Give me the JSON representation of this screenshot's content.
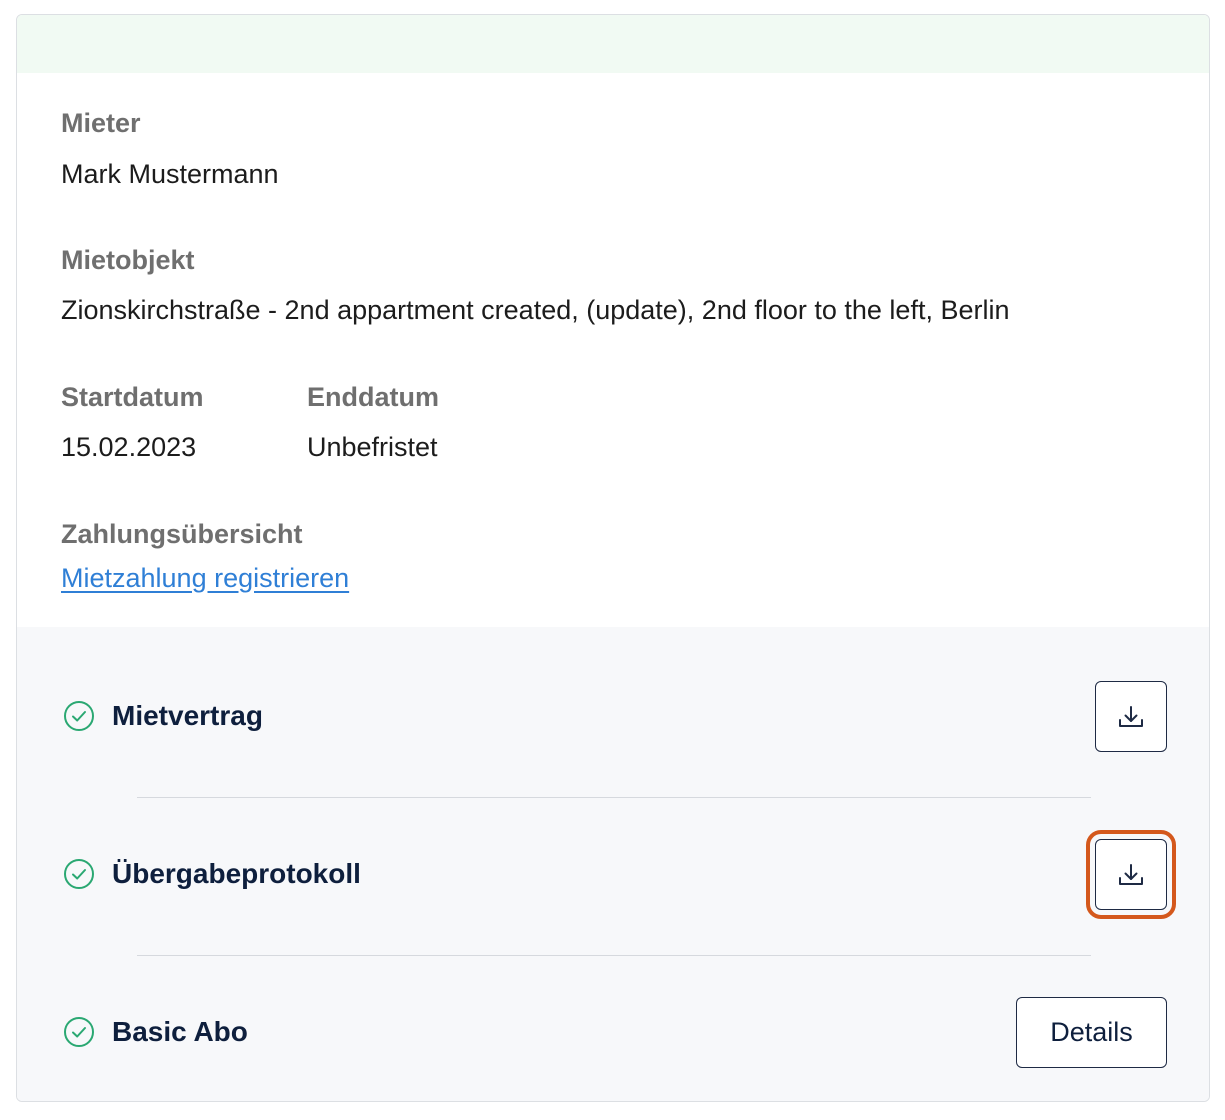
{
  "lease": {
    "tenant_label": "Mieter",
    "tenant_value": "Mark Mustermann",
    "property_label": "Mietobjekt",
    "property_value": "Zionskirchstraße - 2nd appartment created, (update), 2nd floor to the left, Berlin",
    "start_label": "Startdatum",
    "start_value": "15.02.2023",
    "end_label": "Enddatum",
    "end_value": "Unbefristet",
    "payments_label": "Zahlungsübersicht",
    "payments_link": "Mietzahlung registrieren"
  },
  "documents": [
    {
      "title": "Mietvertrag",
      "status_icon": "check-circle-icon",
      "action": "download-icon"
    },
    {
      "title": "Übergabeprotokoll",
      "status_icon": "check-circle-icon",
      "action": "download-icon",
      "highlighted": true
    },
    {
      "title": "Basic Abo",
      "status_icon": "check-circle-icon",
      "action_label": "Details"
    }
  ],
  "colors": {
    "check_green": "#2aa872",
    "link_blue": "#2f7fd6",
    "highlight_orange": "#d4581c",
    "title_navy": "#0e1f3d"
  }
}
